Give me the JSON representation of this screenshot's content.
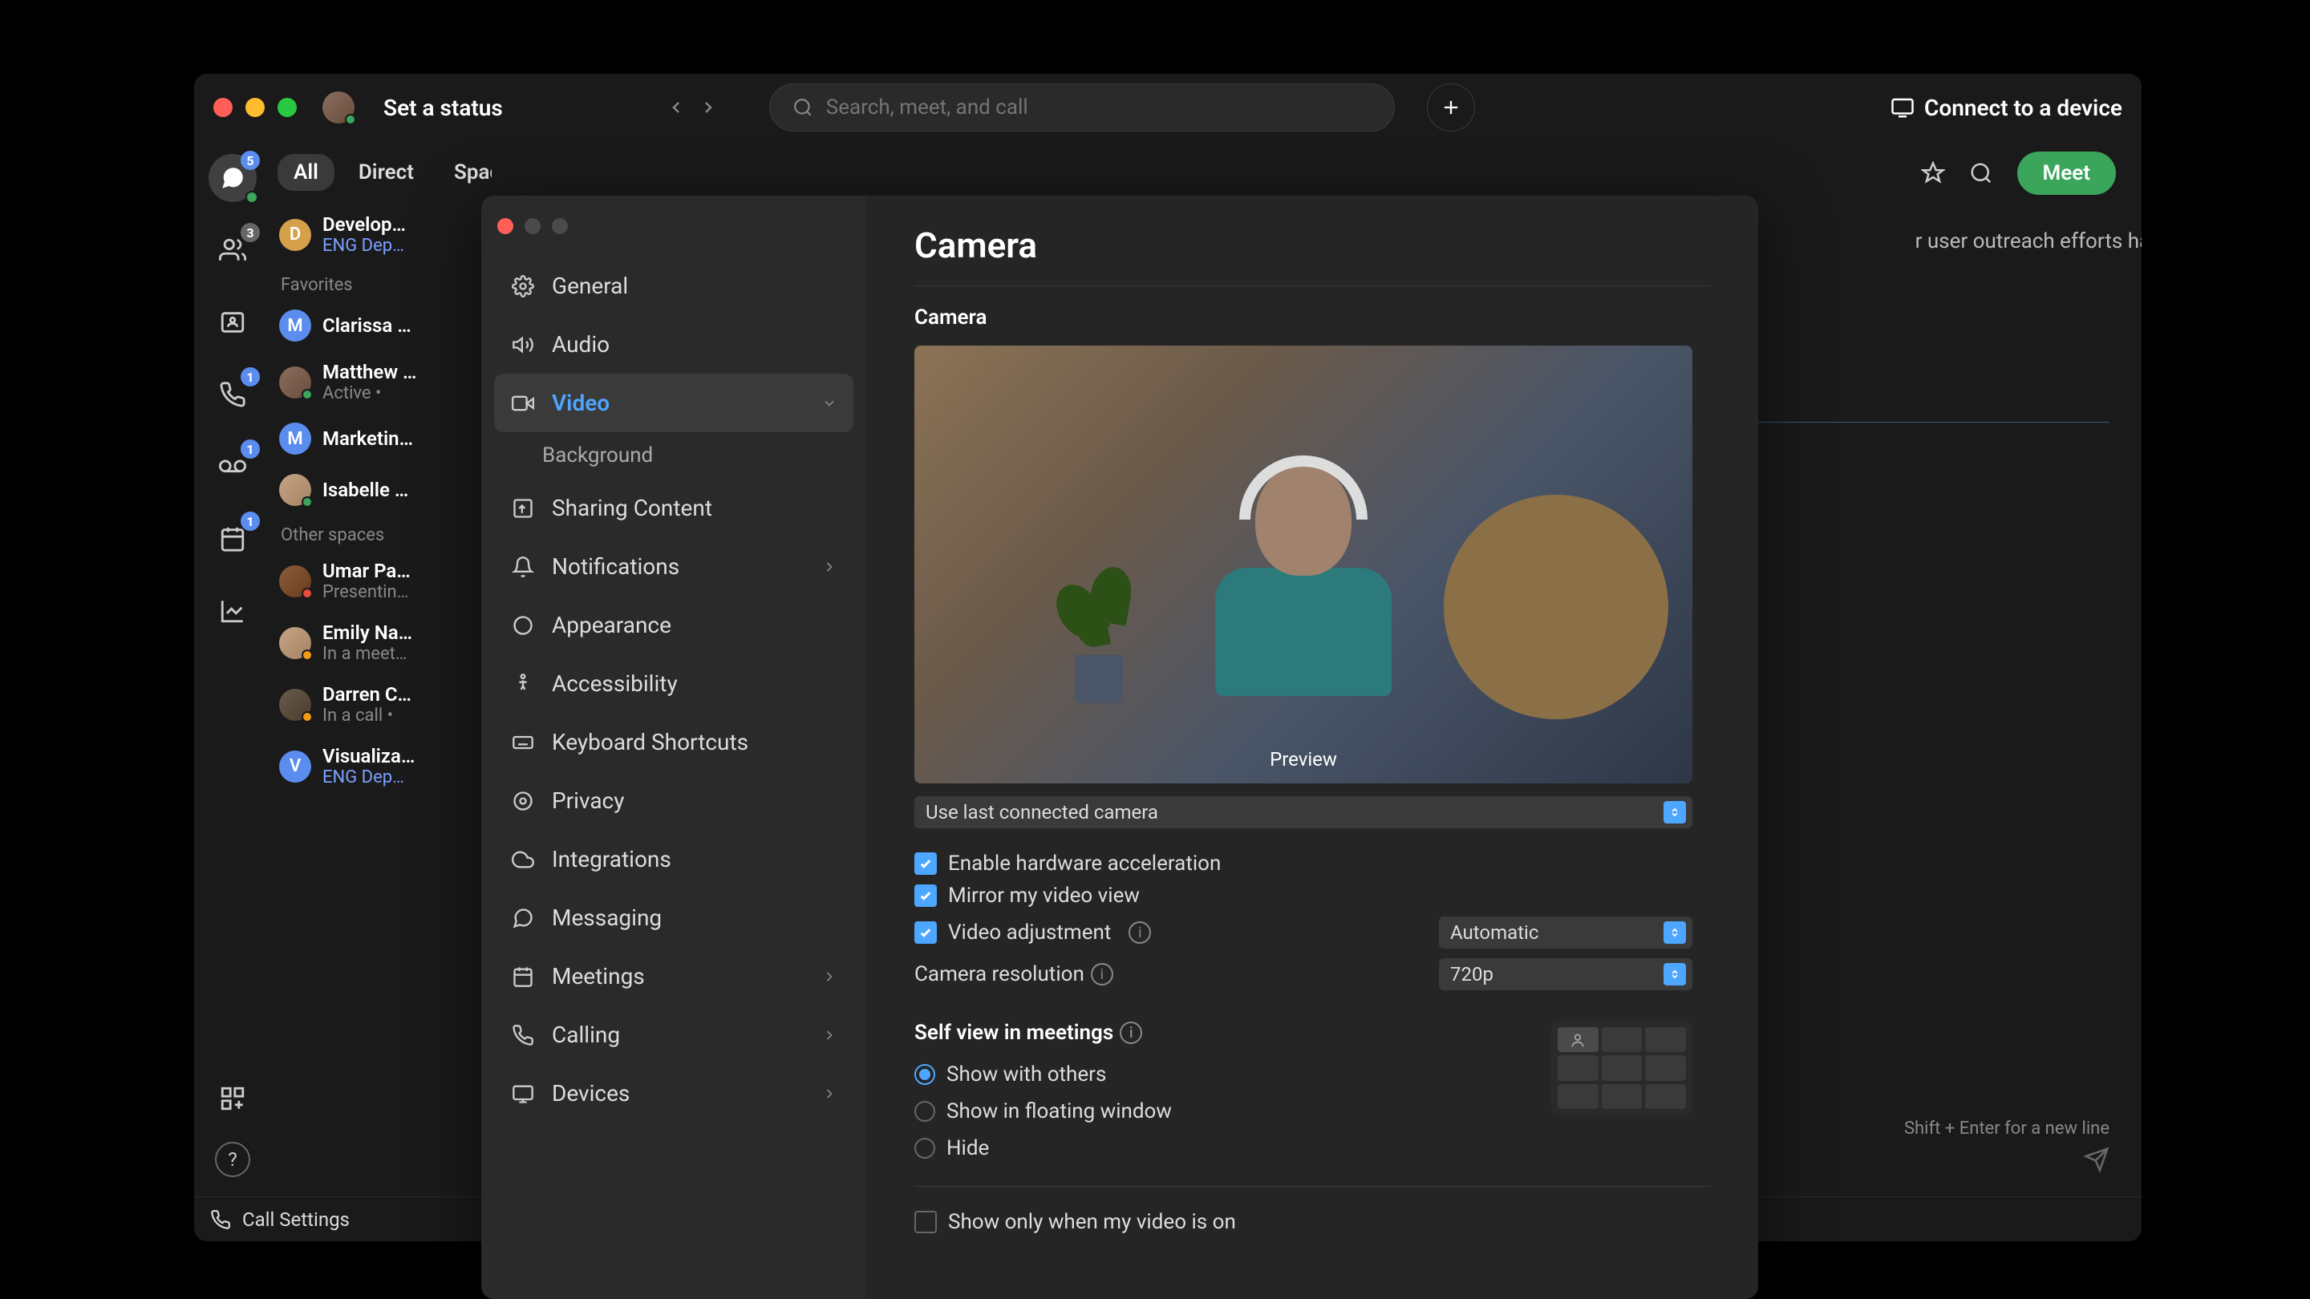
{
  "titlebar": {
    "status": "Set a status",
    "search_placeholder": "Search, meet, and call",
    "connect": "Connect to a device"
  },
  "rail": {
    "badges": {
      "messaging": "5",
      "contacts": "3",
      "calls": "1",
      "voicemail": "1",
      "meetings": "1"
    }
  },
  "tabs": [
    "All",
    "Direct",
    "Spaces"
  ],
  "sections": {
    "favorites": "Favorites",
    "other": "Other spaces"
  },
  "conversations": {
    "top": {
      "title": "Develop…",
      "sub": "ENG Dep…"
    },
    "favorites": [
      {
        "title": "Clarissa …",
        "sub": "",
        "initial": "M",
        "bg": "#5a8dee"
      },
      {
        "title": "Matthew …",
        "sub": "Active  •",
        "avatar": true
      },
      {
        "title": "Marketin…",
        "sub": "",
        "initial": "M",
        "bg": "#5a8dee"
      },
      {
        "title": "Isabelle …",
        "sub": "",
        "avatar": true
      }
    ],
    "other": [
      {
        "title": "Umar Pa…",
        "sub": "Presentin…",
        "avatar": true,
        "status": "dnd"
      },
      {
        "title": "Emily Na…",
        "sub": "In a meet…",
        "avatar": true,
        "status": "meeting"
      },
      {
        "title": "Darren C…",
        "sub": "In a call  •",
        "avatar": true,
        "status": "call"
      },
      {
        "title": "Visualiza…",
        "sub": "ENG Dep…",
        "initial": "V",
        "bg": "#5a8dee"
      }
    ]
  },
  "footer": {
    "call_settings": "Call Settings"
  },
  "chat": {
    "meet": "Meet",
    "snippet": "r user outreach efforts have tal…",
    "hint": "Shift + Enter for a new line"
  },
  "settings": {
    "items": [
      {
        "label": "General",
        "icon": "gear"
      },
      {
        "label": "Audio",
        "icon": "speaker"
      },
      {
        "label": "Video",
        "icon": "video",
        "active": true,
        "expand": true
      },
      {
        "label": "Background",
        "sub": true
      },
      {
        "label": "Sharing Content",
        "icon": "share"
      },
      {
        "label": "Notifications",
        "icon": "bell",
        "expand": true
      },
      {
        "label": "Appearance",
        "icon": "appearance"
      },
      {
        "label": "Accessibility",
        "icon": "accessibility"
      },
      {
        "label": "Keyboard Shortcuts",
        "icon": "keyboard"
      },
      {
        "label": "Privacy",
        "icon": "privacy"
      },
      {
        "label": "Integrations",
        "icon": "cloud"
      },
      {
        "label": "Messaging",
        "icon": "message"
      },
      {
        "label": "Meetings",
        "icon": "calendar",
        "expand": true
      },
      {
        "label": "Calling",
        "icon": "phone",
        "expand": true
      },
      {
        "label": "Devices",
        "icon": "device",
        "expand": true
      }
    ]
  },
  "camera": {
    "title": "Camera",
    "section": "Camera",
    "preview": "Preview",
    "camera_select": "Use last connected camera",
    "hw_accel": "Enable hardware acceleration",
    "mirror": "Mirror my video view",
    "video_adj": "Video adjustment",
    "video_adj_value": "Automatic",
    "resolution": "Camera resolution",
    "resolution_value": "720p",
    "self_view": "Self view in meetings",
    "radio1": "Show with others",
    "radio2": "Show in floating window",
    "radio3": "Hide",
    "show_only": "Show only when my video is on"
  }
}
